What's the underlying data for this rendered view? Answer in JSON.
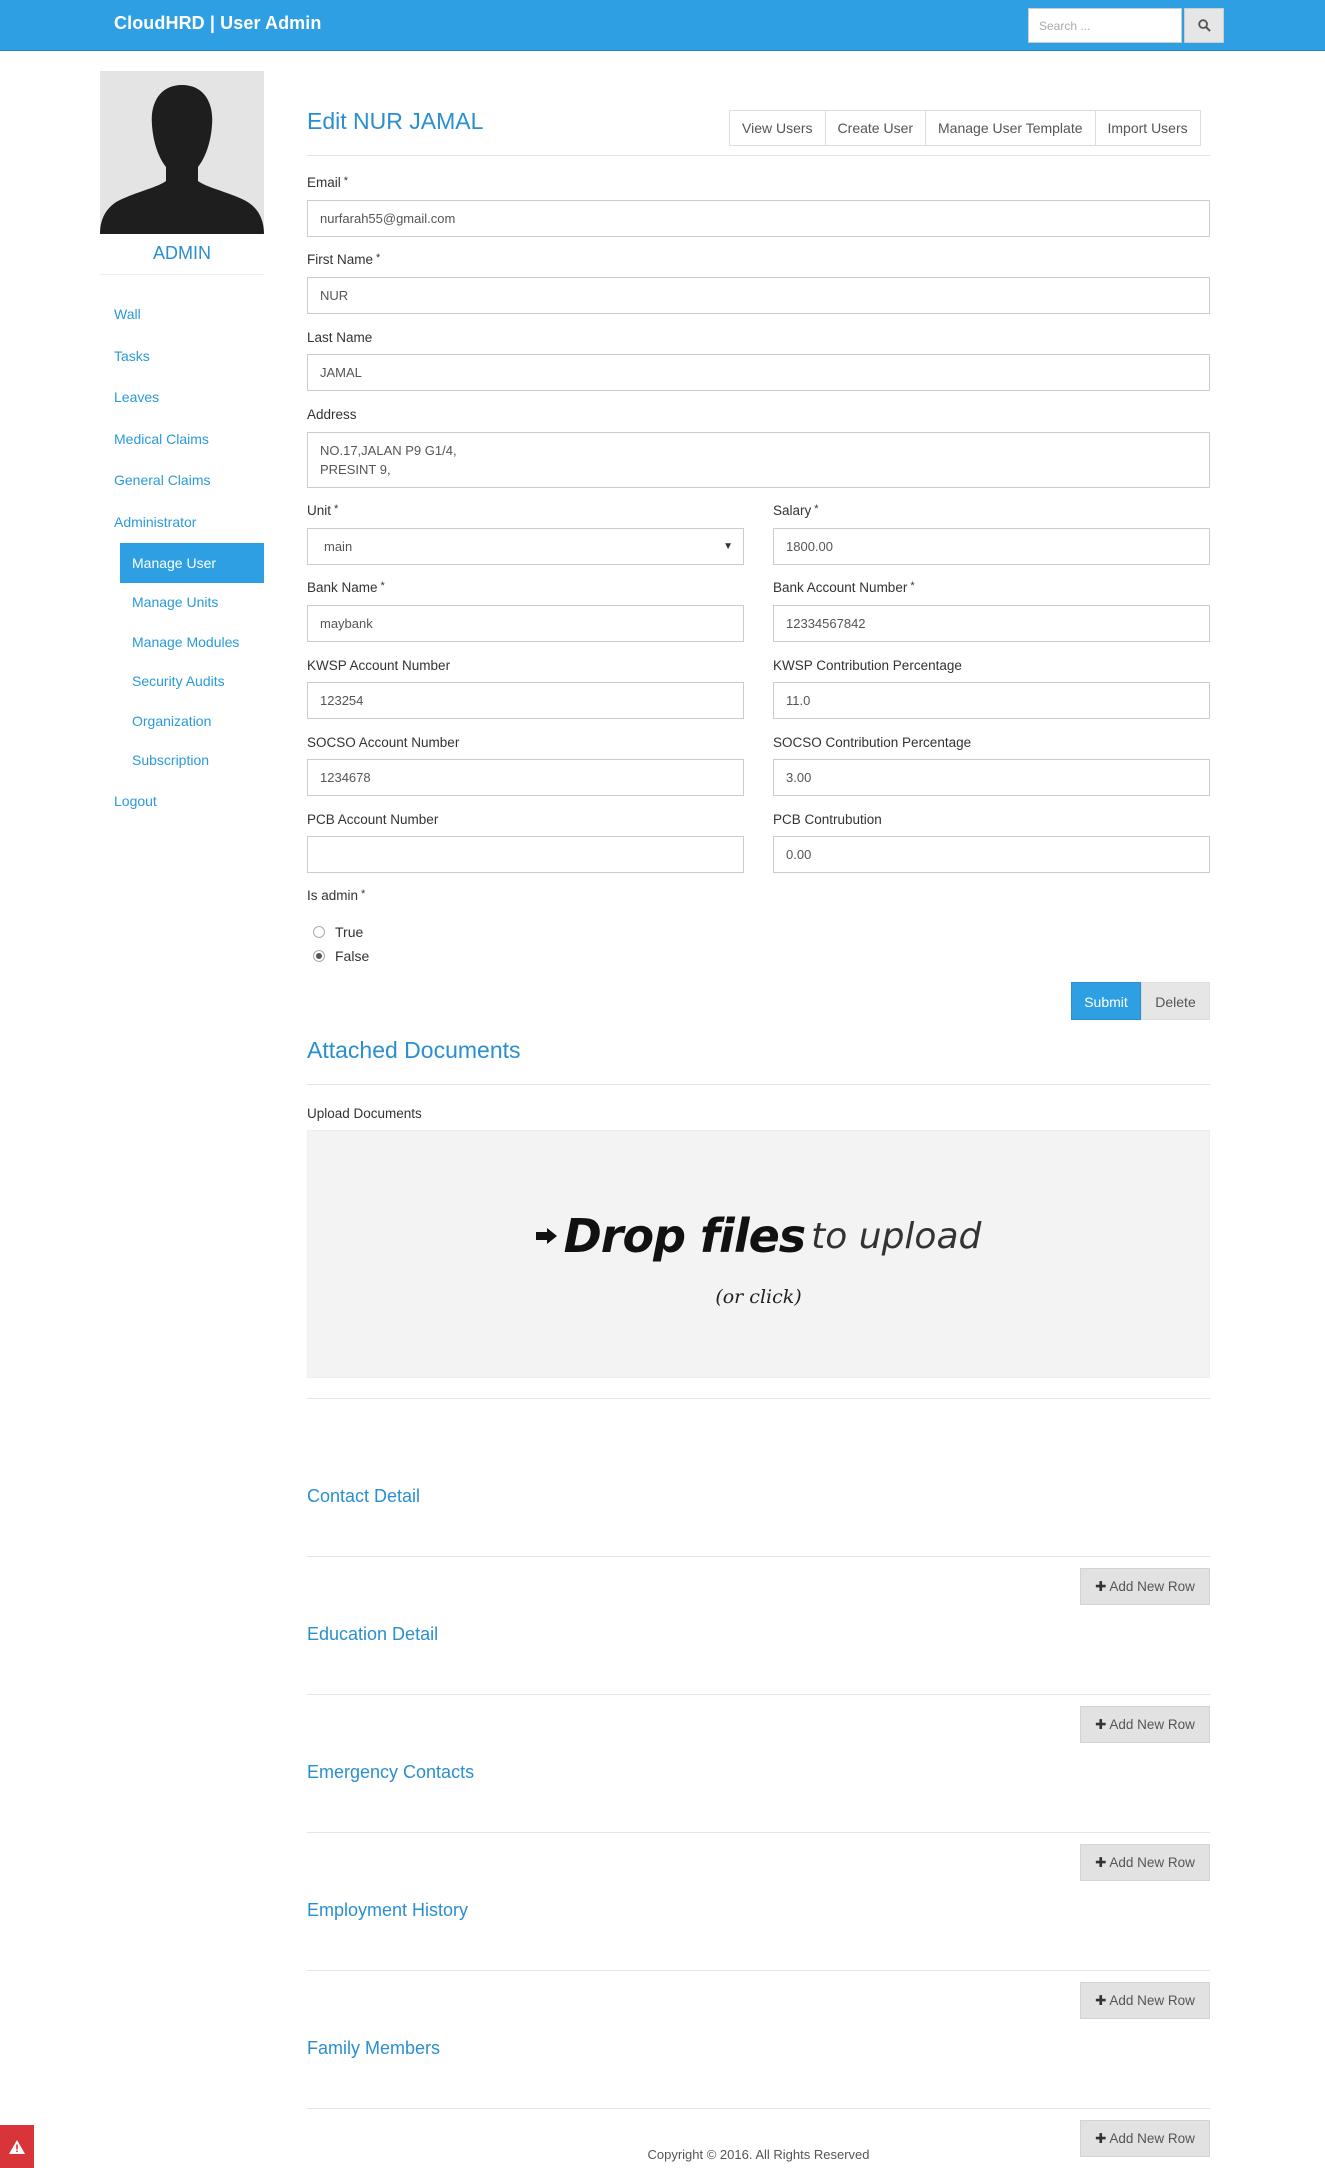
{
  "header": {
    "brand": "CloudHRD | User Admin",
    "search_placeholder": "Search ...",
    "search_icon": "search-icon"
  },
  "sidebar": {
    "avatar_icon": "user-silhouette-icon",
    "role": "ADMIN",
    "items": [
      {
        "label": "Wall"
      },
      {
        "label": "Tasks"
      },
      {
        "label": "Leaves"
      },
      {
        "label": "Medical Claims"
      },
      {
        "label": "General Claims"
      },
      {
        "label": "Administrator"
      }
    ],
    "admin_sub": [
      {
        "label": "Manage User",
        "active": true
      },
      {
        "label": "Manage Units"
      },
      {
        "label": "Manage Modules"
      },
      {
        "label": "Security Audits"
      },
      {
        "label": "Organization"
      },
      {
        "label": "Subscription"
      }
    ],
    "logout": "Logout"
  },
  "main": {
    "title": "Edit NUR JAMAL",
    "toolbar": [
      "View Users",
      "Create User",
      "Manage User Template",
      "Import Users"
    ],
    "form": {
      "required_mark": "*",
      "email": {
        "label": "Email",
        "value": "nurfarah55@gmail.com"
      },
      "first_name": {
        "label": "First Name",
        "value": "NUR"
      },
      "last_name": {
        "label": "Last Name",
        "value": "JAMAL"
      },
      "address": {
        "label": "Address",
        "line1": "NO.17,JALAN P9 G1/4,",
        "line2": "PRESINT 9,"
      },
      "unit": {
        "label": "Unit",
        "value": "main"
      },
      "salary": {
        "label": "Salary",
        "value": "1800.00"
      },
      "bank_name": {
        "label": "Bank Name",
        "value": "maybank"
      },
      "bank_account": {
        "label": "Bank Account Number",
        "value": "12334567842"
      },
      "kwsp_account": {
        "label": "KWSP Account Number",
        "value": "123254"
      },
      "kwsp_percent": {
        "label": "KWSP Contribution Percentage",
        "value": "11.0"
      },
      "socso_account": {
        "label": "SOCSO Account Number",
        "value": "1234678"
      },
      "socso_percent": {
        "label": "SOCSO Contribution Percentage",
        "value": "3.00"
      },
      "pcb_account": {
        "label": "PCB Account Number",
        "value": ""
      },
      "pcb_contribution": {
        "label": "PCB Contrubution",
        "value": "0.00"
      },
      "is_admin": {
        "label": "Is admin",
        "options": [
          "True",
          "False"
        ],
        "selected": "False"
      },
      "submit": "Submit",
      "delete": "Delete"
    },
    "attached": {
      "title": "Attached Documents",
      "upload_label": "Upload Documents",
      "drop_strong": "Drop files",
      "drop_light": "to upload",
      "drop_sub": "(or click)"
    },
    "sections": [
      {
        "title": "Contact Detail",
        "button": "Add New Row"
      },
      {
        "title": "Education Detail",
        "button": "Add New Row"
      },
      {
        "title": "Emergency Contacts",
        "button": "Add New Row"
      },
      {
        "title": "Employment History",
        "button": "Add New Row"
      },
      {
        "title": "Family Members",
        "button": "Add New Row"
      }
    ]
  },
  "footer": {
    "text": "Copyright © 2016. All Rights Reserved"
  },
  "colors": {
    "primary": "#2f9fe3",
    "link": "#2a9ad9",
    "warning": "#d9343a"
  }
}
